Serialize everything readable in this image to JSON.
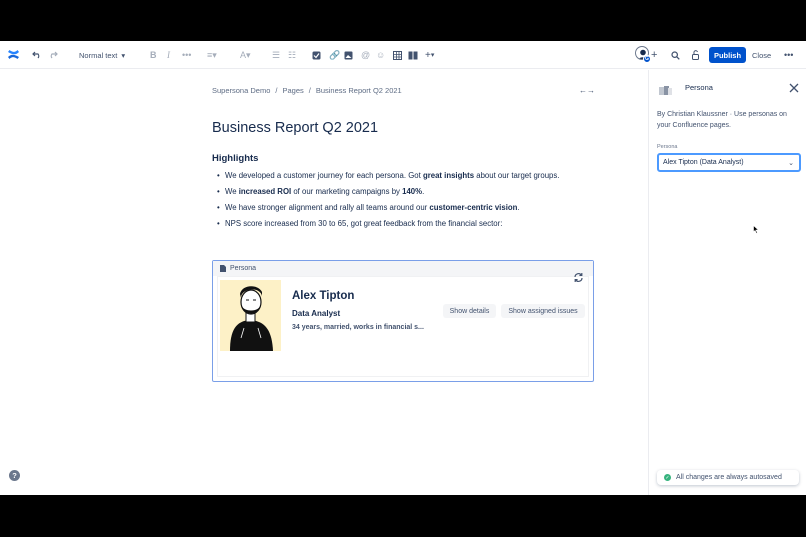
{
  "toolbar": {
    "text_style": "Normal text",
    "publish": "Publish",
    "close": "Close",
    "avatar_badge": "G"
  },
  "breadcrumb": [
    "Supersona Demo",
    "Pages",
    "Business Report Q2 2021"
  ],
  "page": {
    "title": "Business Report Q2 2021",
    "section_heading": "Highlights",
    "bullets": [
      {
        "a": "We developed a customer journey for each persona. Got ",
        "b": "great insights",
        "c": " about our target groups."
      },
      {
        "a": "We ",
        "b": "increased ROI",
        "c": " of our marketing campaigns by ",
        "d": "140%",
        "e": "."
      },
      {
        "a": "We have stronger alignment and rally all teams around our ",
        "b": "customer-centric vision",
        "c": "."
      },
      {
        "a": "NPS score increased from 30 to 65,  got great feedback from the financial sector:"
      }
    ]
  },
  "macro": {
    "label": "Persona",
    "name": "Alex Tipton",
    "role": "Data Analyst",
    "description": "34 years, married, works in financial s...",
    "show_details": "Show details",
    "show_issues": "Show assigned issues"
  },
  "panel": {
    "title": "Persona",
    "description": "By Christian Klaussner · Use personas on your Confluence pages.",
    "field_label": "Persona",
    "selected": "Alex Tipton (Data Analyst)"
  },
  "autosave": "All changes are always autosaved",
  "help": "?",
  "colors": {
    "accent": "#0052cc",
    "focus": "#4c9aff",
    "success": "#36b37e",
    "portrait_bg": "#fdf1c7"
  }
}
